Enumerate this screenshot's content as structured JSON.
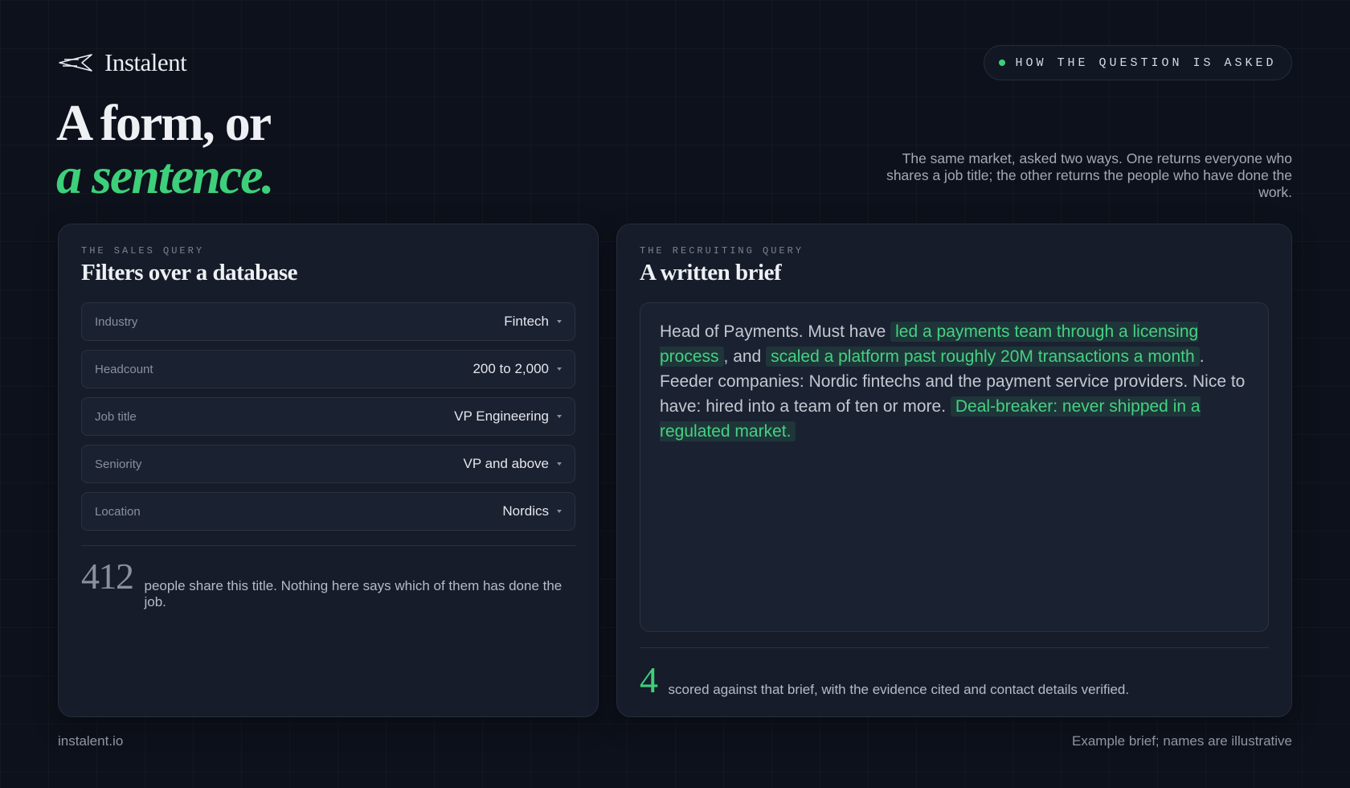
{
  "brand": {
    "name": "Instalent",
    "site": "instalent.io"
  },
  "badge": {
    "text": "HOW THE QUESTION IS ASKED",
    "accent": "#3ecf7a"
  },
  "headline": {
    "line1": "A form, or",
    "line2": "a sentence."
  },
  "intro": "The same market, asked two ways. One returns everyone who shares a job title; the other returns the people who have done the work.",
  "sales": {
    "kicker": "THE SALES QUERY",
    "title": "Filters over a database",
    "filters": [
      {
        "label": "Industry",
        "value": "Fintech"
      },
      {
        "label": "Headcount",
        "value": "200 to 2,000"
      },
      {
        "label": "Job title",
        "value": "VP Engineering"
      },
      {
        "label": "Seniority",
        "value": "VP and above"
      },
      {
        "label": "Location",
        "value": "Nordics"
      }
    ],
    "count": "412",
    "result_text": "people share this title. Nothing here says which of them has done the job."
  },
  "recruiting": {
    "kicker": "THE RECRUITING QUERY",
    "title": "A written brief",
    "brief": {
      "t1": "Head of Payments. Must have ",
      "h1": "led a payments team through a licensing process",
      "t2": ", and ",
      "h2": "scaled a platform past roughly 20M transactions a month",
      "t3": ". Feeder companies: Nordic fintechs and the payment service providers. Nice to have: hired into a team of ten or more. ",
      "h3": "Deal-breaker: never shipped in a regulated market."
    },
    "count": "4",
    "result_text": "scored against that brief, with the evidence cited and contact details verified."
  },
  "footer": {
    "note": "Example brief; names are illustrative"
  },
  "colors": {
    "background": "#0d111b",
    "card": "#161c2a",
    "accent": "#3ecf7a"
  }
}
